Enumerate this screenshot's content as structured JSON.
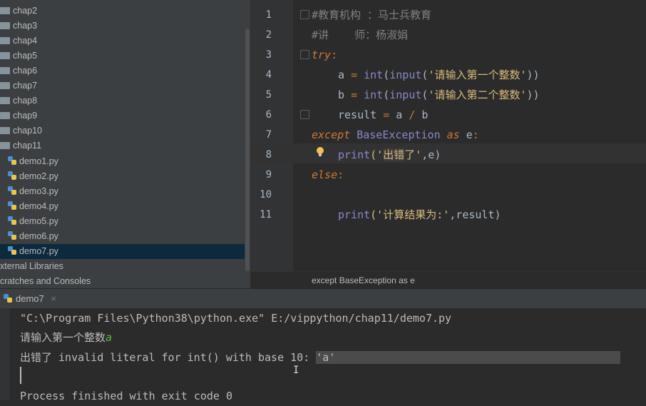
{
  "project_tree": {
    "folders": [
      "chap2",
      "chap3",
      "chap4",
      "chap5",
      "chap6",
      "chap7",
      "chap8",
      "chap9",
      "chap10",
      "chap11"
    ],
    "files": [
      "demo1.py",
      "demo2.py",
      "demo3.py",
      "demo4.py",
      "demo5.py",
      "demo6.py",
      "demo7.py"
    ],
    "selected_file": "demo7.py",
    "external_libraries": "xternal Libraries",
    "scratches": "cratches and Consoles"
  },
  "editor": {
    "line_numbers": [
      "1",
      "2",
      "3",
      "4",
      "5",
      "6",
      "7",
      "8",
      "9",
      "10",
      "11"
    ],
    "line1": "#教育机构 ：马士兵教育",
    "line2": "#讲    师：杨淑娟",
    "line3_kw": "try",
    "line3_colon": ":",
    "line4": {
      "lhs": "a",
      "eq": "=",
      "fn1": "int",
      "fn2": "input",
      "str": "'请输入第一个整数'",
      "close": "))"
    },
    "line5": {
      "lhs": "b",
      "eq": "=",
      "fn1": "int",
      "fn2": "input",
      "str": "'请输入第二个整数'",
      "close": "))"
    },
    "line6": {
      "lhs": "result",
      "eq": "=",
      "a": "a",
      "op": "/",
      "b": "b"
    },
    "line7": {
      "kw": "except",
      "cls": "BaseException",
      "as": "as",
      "var": "e",
      "colon": ":"
    },
    "line8": {
      "fn": "print",
      "open": "('",
      "str_hl": "出错",
      "str_rest": "了'",
      "rest": ",e)"
    },
    "line9_kw": "else",
    "line9_colon": ":",
    "line11": {
      "fn": "print",
      "str": "('计算结果为:'",
      "rest": ",result)"
    }
  },
  "breadcrumb": "except BaseException as e",
  "run_tab": {
    "label": "demo7",
    "close": "×"
  },
  "console": {
    "line1": "\"C:\\Program Files\\Python38\\python.exe\" E:/vippython/chap11/demo7.py",
    "line2_prompt": "请输入第一个整数",
    "line2_input": "a",
    "line3_main": "出错了 invalid literal for int() with base 10: ",
    "line3_sel": "'a'",
    "line4": "Process finished with exit code 0"
  },
  "colors": {
    "keyword": "#cc7832",
    "string": "#6a8759",
    "comment": "#808080",
    "builtin": "#8888c6",
    "selection": "#0d293e"
  }
}
